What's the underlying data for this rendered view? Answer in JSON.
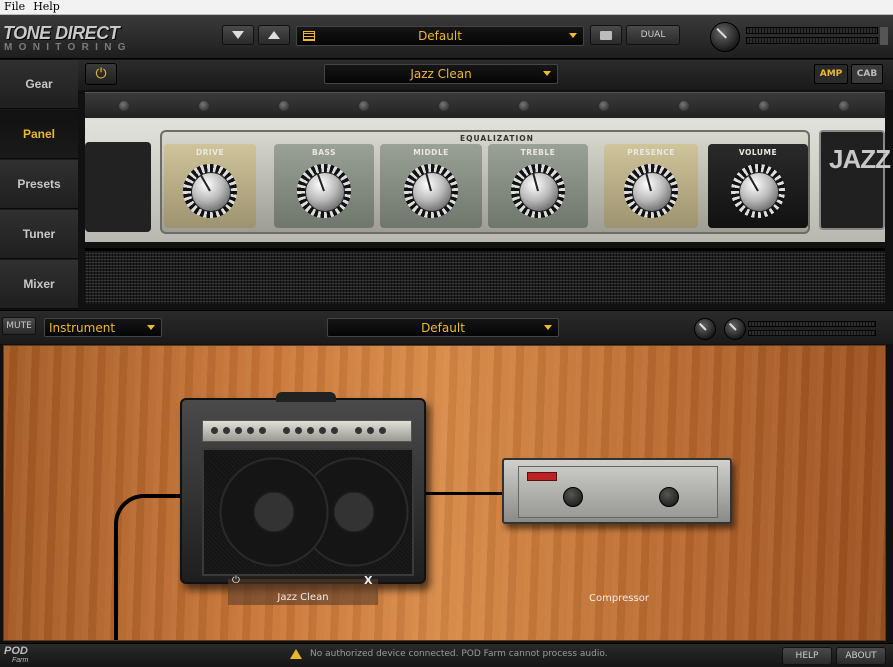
{
  "menu": {
    "file": "File",
    "help": "Help"
  },
  "logo": {
    "line1": "TONE DIRECT",
    "line2": "MONITORING"
  },
  "toolbar": {
    "preset_value": "Default",
    "dual_label": "DUAL"
  },
  "sidebar": {
    "items": [
      {
        "label": "Gear"
      },
      {
        "label": "Panel"
      },
      {
        "label": "Presets"
      },
      {
        "label": "Tuner"
      },
      {
        "label": "Mixer"
      }
    ],
    "active": "Panel"
  },
  "amp_panel": {
    "model_value": "Jazz Clean",
    "amp_toggle": "AMP",
    "cab_toggle": "CAB",
    "eq_label": "EQUALIZATION",
    "knobs": [
      {
        "label": "DRIVE"
      },
      {
        "label": "BASS"
      },
      {
        "label": "MIDDLE"
      },
      {
        "label": "TREBLE"
      },
      {
        "label": "PRESENCE"
      },
      {
        "label": "VOLUME"
      }
    ],
    "nameplate": "JAZZ C"
  },
  "chain": {
    "mute_label": "MUTE",
    "input_value": "Instrument",
    "preset_value": "Default"
  },
  "stage": {
    "amp_label": "Jazz Clean",
    "comp_label": "Compressor",
    "close_glyph": "X"
  },
  "status": {
    "pod_logo": "POD",
    "pod_logo2": "Farm",
    "message": "No authorized device connected. POD Farm cannot process audio.",
    "help_label": "HELP",
    "about_label": "ABOUT"
  },
  "colors": {
    "accent": "#f0b929",
    "wood": "#c9773a"
  }
}
